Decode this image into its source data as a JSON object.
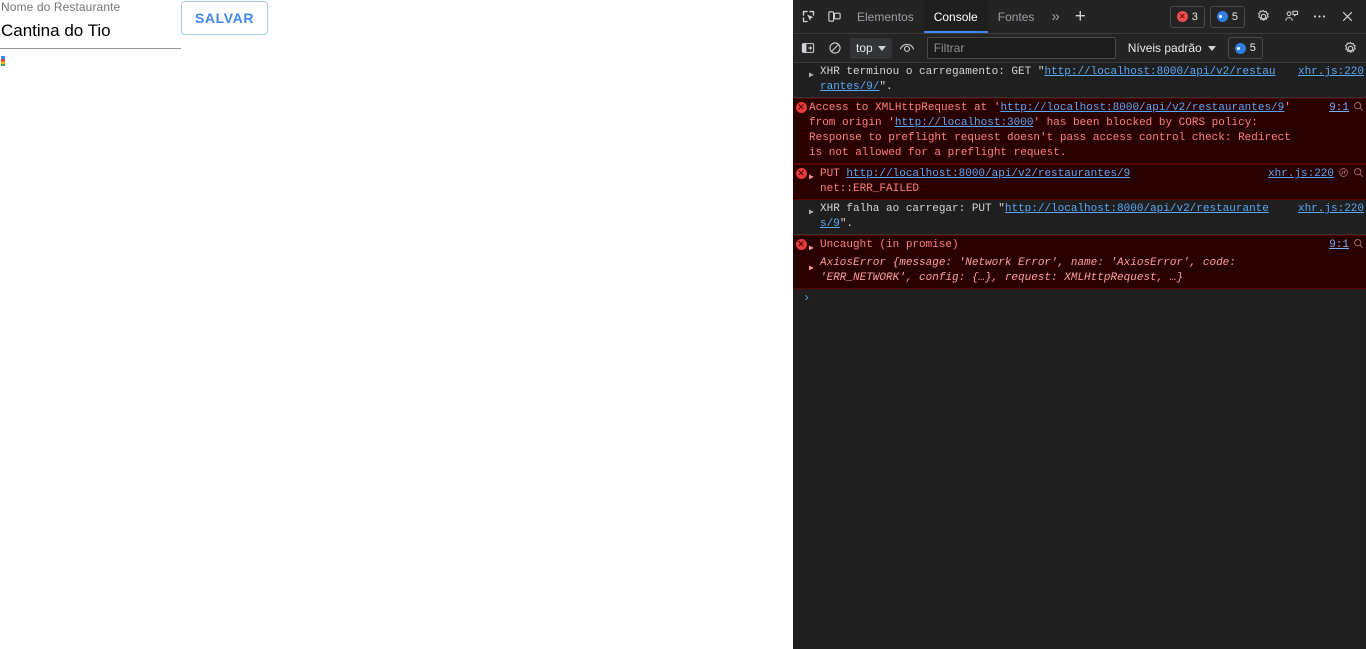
{
  "page": {
    "form": {
      "label": "Nome do Restaurante",
      "value": "Cantina do Tio",
      "placeholder": "",
      "save_label": "SALVAR",
      "broken_image_alt": ","
    }
  },
  "devtools": {
    "tabs": [
      {
        "label": "Elementos",
        "active": false
      },
      {
        "label": "Console",
        "active": true
      },
      {
        "label": "Fontes",
        "active": false
      }
    ],
    "more_tabs_label": "»",
    "add_tab_label": "+",
    "error_count": "3",
    "info_count": "5",
    "icons": {
      "inspect": "inspect-element-icon",
      "device": "device-toolbar-icon",
      "settings": "gear-icon",
      "feedback": "feedback-icon",
      "more": "more-options-icon",
      "close": "close-icon"
    },
    "filterbar": {
      "sidebar_toggle": "console-sidebar-icon",
      "clear_label": "clear-console-icon",
      "context": "top",
      "eye_label": "live-expression-icon",
      "filter_placeholder": "Filtrar",
      "filter_value": "",
      "levels_label": "Níveis padrão",
      "levels_count": "5",
      "settings_label": "gear-icon"
    },
    "console": {
      "messages": [
        {
          "type": "info",
          "arrow": "▶",
          "text_prefix": "XHR terminou o carregamento: GET \"",
          "link": "http://localhost:8000/api/v2/restaurantes/9/",
          "text_suffix": "\".",
          "source": "xhr.js:220",
          "source_extra": ""
        },
        {
          "type": "error",
          "arrow": "",
          "text_prefix": "Access to XMLHttpRequest at '",
          "link": "http://localhost:8000/api/v2/restaurantes/9",
          "text_mid": "' from origin '",
          "link2": "http://localhost:3000",
          "text_suffix": "' has been blocked by CORS policy: Response to preflight request doesn't pass access control check: Redirect is not allowed for a preflight request.",
          "source": "9:1",
          "source_extra": "magnifier-icon"
        },
        {
          "type": "error",
          "arrow": "▶",
          "text_prefix": "PUT ",
          "link": "http://localhost:8000/api/v2/restaurantes/9",
          "text_suffix": "",
          "sub_text": "net::ERR_FAILED",
          "source": "xhr.js:220",
          "source_extra": "reload-icon magnifier-icon"
        },
        {
          "type": "info",
          "arrow": "▶",
          "text_prefix": "XHR falha ao carregar: PUT \"",
          "link": "http://localhost:8000/api/v2/restaurantes/9",
          "text_suffix": "\".",
          "source": "xhr.js:220",
          "source_extra": ""
        },
        {
          "type": "error",
          "arrow": "▶",
          "text_prefix": "Uncaught (in promise)",
          "object_text": "AxiosError {message: 'Network Error', name: 'AxiosError', code: 'ERR_NETWORK', config: {…}, request: XMLHttpRequest, …}",
          "source": "9:1",
          "source_extra": "magnifier-icon"
        }
      ],
      "prompt_symbol": "›"
    }
  },
  "colors": {
    "accent_blue": "#4285f4",
    "link_blue": "#5ba7f7",
    "error_red": "#ff8080",
    "error_bg": "#290000",
    "devtools_bg": "#1f1f1f",
    "toolbar_bg": "#242424"
  }
}
